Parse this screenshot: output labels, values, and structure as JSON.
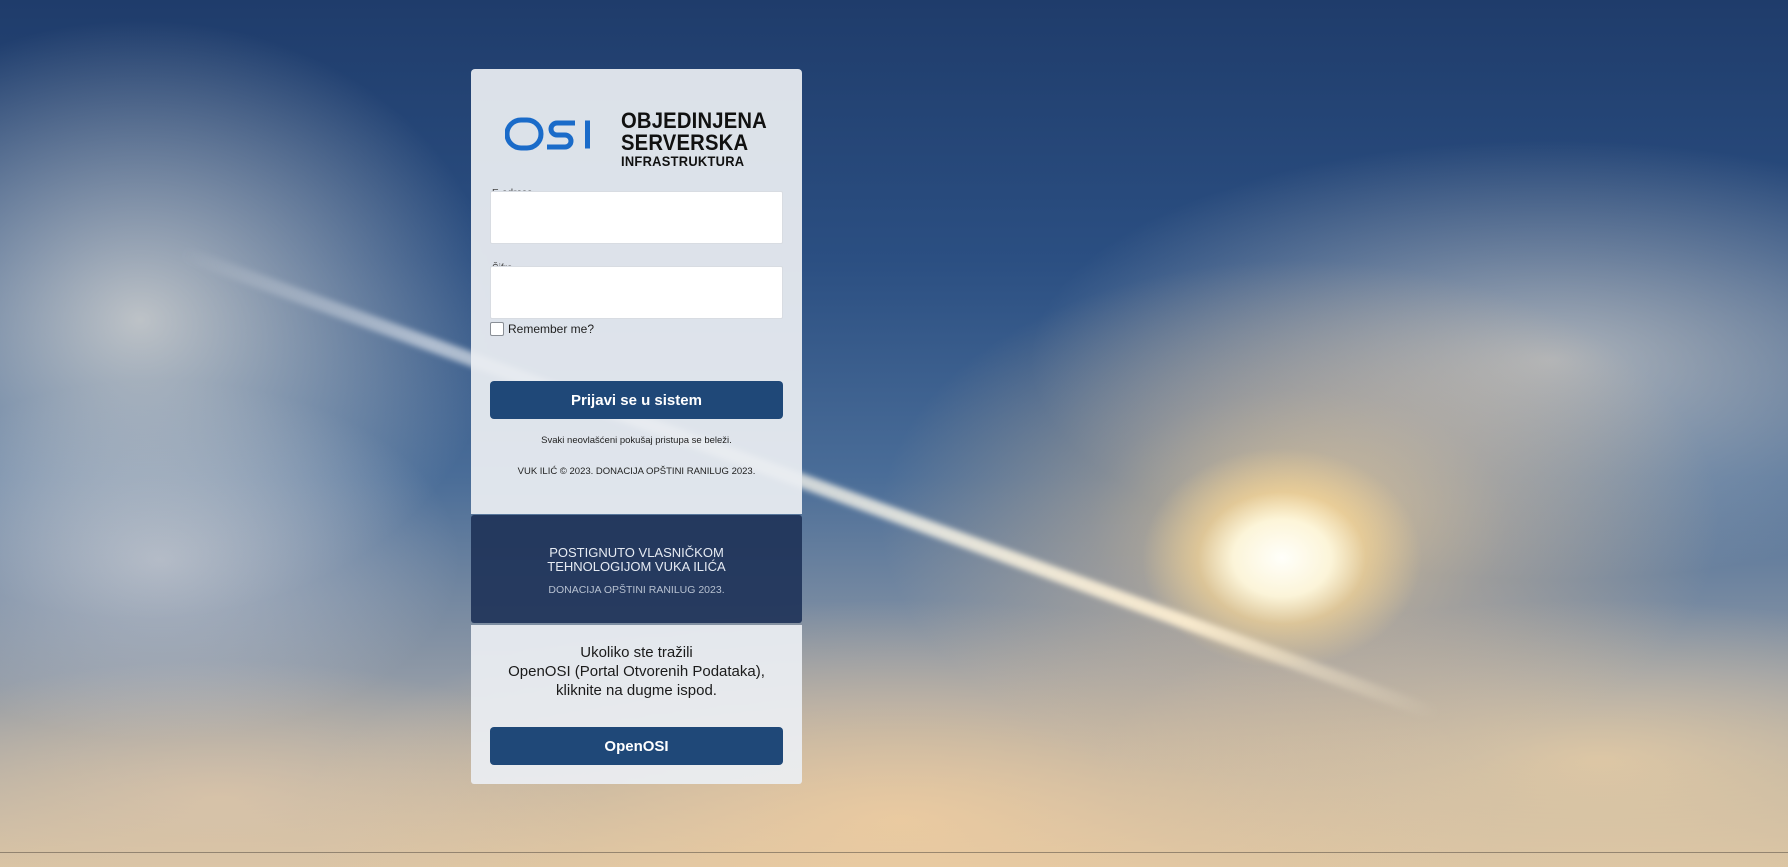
{
  "colors": {
    "button": "#1f4878",
    "brand_panel": "#1e3258",
    "logo_blue": "#1a6bc9",
    "card": "#ebeef2"
  },
  "logo": {
    "mark": "OSI",
    "line1": "OBJEDINJENA",
    "line2": "SERVERSKA",
    "line3": "INFRASTRUKTURA"
  },
  "login": {
    "email_label": "E-adresa",
    "email_value": "",
    "password_label": "Šifra",
    "password_value": "",
    "remember_label": "Remember me?",
    "remember_checked": false,
    "submit_label": "Prijavi se u sistem",
    "warning": "Svaki neovlašćeni pokušaj pristupa se beleži.",
    "copyright": "VUK ILIĆ © 2023. DONACIJA OPŠTINI RANILUG 2023."
  },
  "brand": {
    "line1": "POSTIGNUTO VLASNIČKOM",
    "line2": "TEHNOLOGIJOM VUKA ILIĆA",
    "sub": "DONACIJA OPŠTINI RANILUG 2023."
  },
  "openosi": {
    "line1": "Ukoliko ste tražili",
    "line2": "OpenOSI (Portal Otvorenih Podataka),",
    "line3": "kliknite na dugme ispod.",
    "button_label": "OpenOSI"
  }
}
